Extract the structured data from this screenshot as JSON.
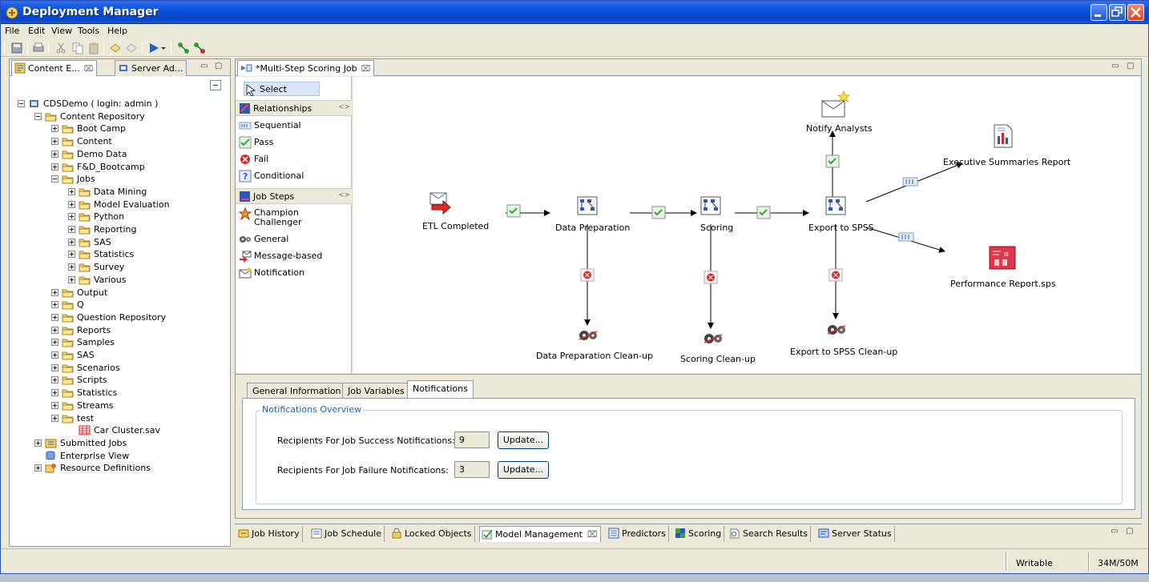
{
  "window": {
    "title": "Deployment Manager"
  },
  "menu": [
    "File",
    "Edit",
    "View",
    "Tools",
    "Help"
  ],
  "left_panel": {
    "tabs": [
      {
        "label": "Content E...",
        "close": "⌧"
      },
      {
        "label": "Server Ad..."
      }
    ],
    "tree": [
      {
        "label": "CDSDemo ( login: admin )",
        "depth": 0,
        "expanded": true,
        "icon": "server-icon"
      },
      {
        "label": "Content Repository",
        "depth": 1,
        "expanded": true,
        "icon": "folder-icon"
      },
      {
        "label": "Boot Camp",
        "depth": 2,
        "expanded": false,
        "icon": "folder-icon"
      },
      {
        "label": "Content",
        "depth": 2,
        "expanded": false,
        "icon": "folder-icon"
      },
      {
        "label": "Demo Data",
        "depth": 2,
        "expanded": false,
        "icon": "folder-icon"
      },
      {
        "label": "F&D_Bootcamp",
        "depth": 2,
        "expanded": false,
        "icon": "folder-icon"
      },
      {
        "label": "Jobs",
        "depth": 2,
        "expanded": true,
        "icon": "folder-icon"
      },
      {
        "label": "Data Mining",
        "depth": 3,
        "expanded": false,
        "icon": "folder-icon"
      },
      {
        "label": "Model Evaluation",
        "depth": 3,
        "expanded": false,
        "icon": "folder-icon"
      },
      {
        "label": "Python",
        "depth": 3,
        "expanded": false,
        "icon": "folder-icon"
      },
      {
        "label": "Reporting",
        "depth": 3,
        "expanded": false,
        "icon": "folder-icon"
      },
      {
        "label": "SAS",
        "depth": 3,
        "expanded": false,
        "icon": "folder-icon"
      },
      {
        "label": "Statistics",
        "depth": 3,
        "expanded": false,
        "icon": "folder-icon"
      },
      {
        "label": "Survey",
        "depth": 3,
        "expanded": false,
        "icon": "folder-icon"
      },
      {
        "label": "Various",
        "depth": 3,
        "expanded": false,
        "icon": "folder-icon"
      },
      {
        "label": "Output",
        "depth": 2,
        "expanded": false,
        "icon": "folder-icon"
      },
      {
        "label": "Q",
        "depth": 2,
        "expanded": false,
        "icon": "folder-icon"
      },
      {
        "label": "Question Repository",
        "depth": 2,
        "expanded": false,
        "icon": "folder-icon"
      },
      {
        "label": "Reports",
        "depth": 2,
        "expanded": false,
        "icon": "folder-icon"
      },
      {
        "label": "Samples",
        "depth": 2,
        "expanded": false,
        "icon": "folder-icon"
      },
      {
        "label": "SAS",
        "depth": 2,
        "expanded": false,
        "icon": "folder-icon"
      },
      {
        "label": "Scenarios",
        "depth": 2,
        "expanded": false,
        "icon": "folder-icon"
      },
      {
        "label": "Scripts",
        "depth": 2,
        "expanded": false,
        "icon": "folder-icon"
      },
      {
        "label": "Statistics",
        "depth": 2,
        "expanded": false,
        "icon": "folder-icon"
      },
      {
        "label": "Streams",
        "depth": 2,
        "expanded": false,
        "icon": "folder-icon"
      },
      {
        "label": "test",
        "depth": 2,
        "expanded": false,
        "icon": "folder-icon"
      },
      {
        "label": "Car Cluster.sav",
        "depth": 3,
        "expanded": null,
        "icon": "data-file-icon"
      },
      {
        "label": "Submitted Jobs",
        "depth": 1,
        "expanded": false,
        "icon": "submitted-jobs-icon"
      },
      {
        "label": "Enterprise View",
        "depth": 1,
        "expanded": null,
        "icon": "enterprise-view-icon"
      },
      {
        "label": "Resource Definitions",
        "depth": 1,
        "expanded": false,
        "icon": "resource-definitions-icon"
      }
    ]
  },
  "editor": {
    "tab": {
      "label": "*Multi-Step Scoring Job",
      "close": "⌧"
    },
    "palette": {
      "select": "Select",
      "relationships_header": "Relationships",
      "relationships": [
        "Sequential",
        "Pass",
        "Fail",
        "Conditional"
      ],
      "job_steps_header": "Job Steps",
      "job_steps": [
        "Champion Challenger",
        "General",
        "Message-based",
        "Notification"
      ]
    },
    "canvas": {
      "nodes": {
        "etl": "ETL  Completed",
        "data_prep": "Data Preparation",
        "scoring": "Scoring",
        "export": "Export to SPSS",
        "notify": "Notify Analysts",
        "exec_report": "Executive Summaries Report",
        "perf_report": "Performance Report.sps",
        "data_prep_cleanup": "Data Preparation Clean-up",
        "scoring_cleanup": "Scoring Clean-up",
        "export_cleanup": "Export to SPSS Clean-up"
      }
    },
    "properties": {
      "tabs": [
        "General Information",
        "Job Variables",
        "Notifications"
      ],
      "active_tab": "Notifications",
      "group_title": "Notifications Overview",
      "success_label": "Recipients For Job Success Notifications:",
      "success_value": "9",
      "failure_label": "Recipients For Job Failure Notifications:",
      "failure_value": "3",
      "update_label": "Update..."
    }
  },
  "bottom_tabs": [
    "Job History",
    "Job Schedule",
    "Locked Objects",
    "Model Management",
    "Predictors",
    "Scoring",
    "Search Results",
    "Server Status"
  ],
  "bottom_active": "Model Management",
  "status": {
    "mode": "Writable",
    "memory": "34M/50M"
  },
  "colors": {
    "title_bar": "#0a4fd4",
    "accent_blue": "#1b5fc8",
    "pass_green": "#3aa33a",
    "fail_red": "#d42a2a"
  }
}
